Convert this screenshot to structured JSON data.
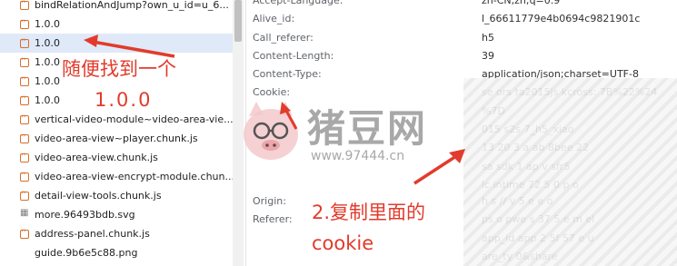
{
  "requests": [
    {
      "name": "bindRelationAndJump?own_u_id=u_6...",
      "type": "xhr",
      "selected": false
    },
    {
      "name": "1.0.0",
      "type": "xhr",
      "selected": false
    },
    {
      "name": "1.0.0",
      "type": "xhr",
      "selected": true
    },
    {
      "name": "1.0.0",
      "type": "xhr",
      "selected": false
    },
    {
      "name": "1.0.0",
      "type": "xhr",
      "selected": false
    },
    {
      "name": "1.0.0",
      "type": "xhr",
      "selected": false
    },
    {
      "name": "vertical-video-module~video-area-vie...",
      "type": "js",
      "selected": false
    },
    {
      "name": "video-area-view~player.chunk.js",
      "type": "js",
      "selected": false
    },
    {
      "name": "video-area-view.chunk.js",
      "type": "js",
      "selected": false
    },
    {
      "name": "video-area-view-encrypt-module.chun...",
      "type": "js",
      "selected": false
    },
    {
      "name": "detail-view-tools.chunk.js",
      "type": "js",
      "selected": false
    },
    {
      "name": "more.96493bdb.svg",
      "type": "svg",
      "selected": false
    },
    {
      "name": "address-panel.chunk.js",
      "type": "js",
      "selected": false
    },
    {
      "name": "guide.9b6e5c88.png",
      "type": "png",
      "selected": false
    }
  ],
  "headers": [
    {
      "name": "Accept-Language:",
      "value": "zh-CN,zh;q=0.9"
    },
    {
      "name": "Alive_id:",
      "value": "l_66611779e4b0694c9821901c"
    },
    {
      "name": "Call_referer:",
      "value": "h5"
    },
    {
      "name": "Content-Length:",
      "value": "39"
    },
    {
      "name": "Content-Type:",
      "value": "application/json;charset=UTF-8"
    },
    {
      "name": "Cookie:",
      "value": "se  ors  ta2015js    kcross:  7B%22%24"
    },
    {
      "name": "",
      "value": "   %7D"
    },
    {
      "name": "",
      "value": "015    s2s  7_h5_xiao"
    },
    {
      "name": "",
      "value": "  13  20  3  a  ab  8bee  22"
    },
    {
      "name": "",
      "value": "sa  sdk  1  ap  v  sfr5"
    },
    {
      "name": "",
      "value": "lc  intime  72  5  0  p  o"
    },
    {
      "name": "Origin:",
      "value": "h  s  //  v  5  e  e  o"
    },
    {
      "name": "Referer:",
      "value": "ps  o  pwe  s  37  5  e  m  el"
    },
    {
      "name": "",
      "value": "app_id  app  2  5f  57  e  u"
    },
    {
      "name": "",
      "value": "are_ty   0&share"
    }
  ],
  "annotations": {
    "step1_line1": "随便找到一个",
    "step1_line2": "1.0.0",
    "step2_line1": "2.复制里面的",
    "step2_line2": "cookie"
  },
  "watermark": {
    "brand": "猪豆网",
    "url": "www.97444.cn"
  },
  "colors": {
    "annotation": "#e23b2c",
    "selected_row": "#dfe9f8",
    "watermark": "#9a9a9a"
  }
}
